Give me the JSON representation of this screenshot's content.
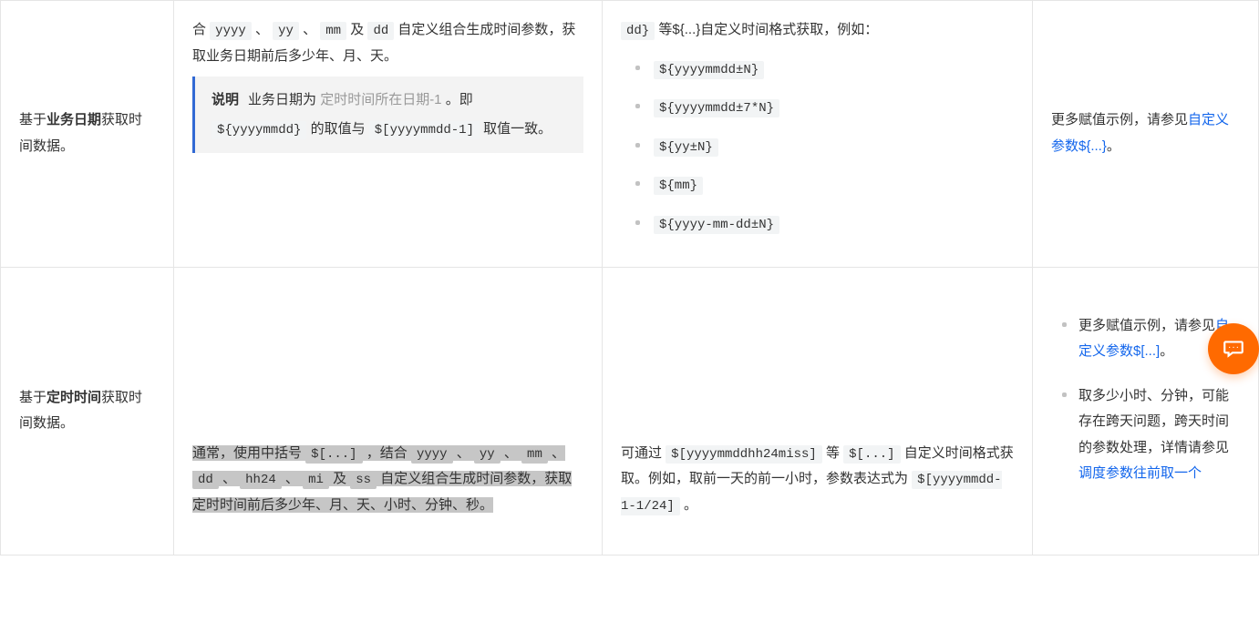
{
  "row1": {
    "col1_a": "基于",
    "col1_b": "业务日期",
    "col1_c": "获取时间数据。",
    "col2_pre": "合 ",
    "c_yyyy": "yyyy",
    "sep": " 、 ",
    "c_yy": "yy",
    "c_mm": "mm",
    "c_and": " 及 ",
    "c_dd": "dd",
    "col2_after": " 自定义组合生成时间参数，获取业务日期前后多少年、月、天。",
    "note_label": "说明",
    "note_a": "业务日期为 ",
    "note_grey": "定时时间所在日期-1",
    "note_b": " 。即 ",
    "note_code1": "${yyyymmdd}",
    "note_c": " 的取值与 ",
    "note_code2": "$[yyyymmdd-1]",
    "note_d": " 取值一致。",
    "col3_a": "dd}",
    "col3_b": " 等",
    "col3_c": "${...}",
    "col3_d": "自定义时间格式获取，例如：",
    "li1": "${yyyymmdd±N}",
    "li2": "${yyyymmdd±7*N}",
    "li3": "${yy±N}",
    "li4": "${mm}",
    "li5": "${yyyy-mm-dd±N}",
    "col4_a": "更多赋值示例，请参见",
    "col4_link": "自定义参数${...}",
    "col4_b": "。"
  },
  "row2": {
    "col1_a": "基于",
    "col1_b": "定时时间",
    "col1_c": "获取时间数据。",
    "h_a": "通常，使用中括号 ",
    "h_code1": "$[...]",
    "h_b": " ，结合 ",
    "h_yyyy": "yyyy",
    "h_yy": "yy",
    "h_mm": "mm",
    "h_dd": "dd",
    "h_hh24": "hh24",
    "h_mi": "mi",
    "h_and": " 及 ",
    "h_ss": "ss",
    "h_after": " 自定义组合生成时间参数，获取定时时间前后多少年、月、天、小时、分钟、秒。",
    "col3_a": "可通过 ",
    "col3_code1": "$[yyyymmddhh24miss]",
    "col3_b": " 等 ",
    "col3_code2": "$[...]",
    "col3_c": " 自定义时间格式获取。例如，取前一天的前一小时，参数表达式为 ",
    "col3_code3": "$[yyyymmdd-1-1/24]",
    "col3_d": " 。",
    "li1_a": "更多赋值示例，请参见",
    "li1_link": "自定义参数$[...]",
    "li1_b": "。",
    "li2_a": "取多少小时、分钟，可能存在跨天问题，跨天时间的参数处理，详情请参见",
    "li2_link": "调度参数往前取一个"
  }
}
